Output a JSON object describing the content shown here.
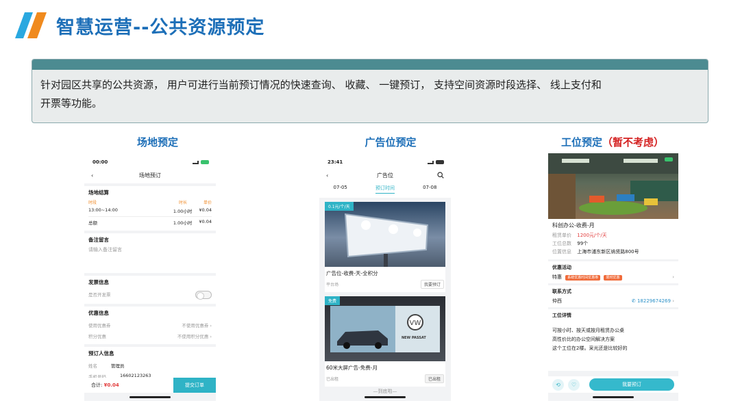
{
  "header": {
    "title": "智慧运营--公共资源预定"
  },
  "description": {
    "line1": "针对园区共享的公共资源， 用户可进行当前预订情况的快速查询、 收藏、 一键预订， 支持空间资源时段选择、 线上支付和",
    "line2": "开票等功能。"
  },
  "columns": {
    "venue_title": "场地预定",
    "ad_title": "广告位预定",
    "workspace_title": "工位预定",
    "workspace_note": "（暂不考虑）"
  },
  "venue_phone": {
    "time": "00:00",
    "nav_title": "场地预订",
    "settle": {
      "title": "场地结算",
      "headers": [
        "时段",
        "时长",
        "单价"
      ],
      "row": [
        "13:00~14:00",
        "1.00小时",
        "¥0.04"
      ],
      "total_label": "总额",
      "total_hours": "1.00小时",
      "total_price": "¥0.04"
    },
    "remark": {
      "title": "备注留言",
      "placeholder": "请输入备注留言"
    },
    "invoice": {
      "title": "发票信息",
      "label": "是否开发票"
    },
    "discount": {
      "title": "优惠信息",
      "coupon_label": "使用优惠券",
      "coupon_value": "不使用优惠券",
      "points_label": "积分优惠",
      "points_value": "不使用积分优惠"
    },
    "booker": {
      "title": "预订人信息",
      "name_label": "姓名",
      "name_value": "管理员",
      "phone_label": "手机号码",
      "phone_value": "16602123263"
    },
    "footer": {
      "total_label": "合计:",
      "total_value": "¥0.04",
      "submit": "提交订单"
    }
  },
  "ad_phone": {
    "time": "23:41",
    "nav_title": "广告位",
    "tabs": [
      "07-05",
      "预订时间",
      "07-08"
    ],
    "card1": {
      "badge": "0.1元/个/天",
      "title": "广告位-收费-天-全积分",
      "meta": "平台场",
      "button": "我要预订"
    },
    "card2": {
      "badge": "免费",
      "title": "60米大屏广告-免费-月",
      "meta": "已出租",
      "button": "已出租",
      "brand": "NEW PASSAT"
    },
    "footer_hint": "—到底啦—"
  },
  "workspace_phone": {
    "name": "科创办公-收费-月",
    "price_label": "租赁单价",
    "price_value": "1200元/个/天",
    "count_label": "工位总数",
    "count_value": "99个",
    "address_label": "位置信息",
    "address_value": "上海市浦东新区纳贤路800号",
    "promo": {
      "title": "优惠活动",
      "label": "特惠",
      "tag1": "系统优惠时间优惠券",
      "tag2": "限时优惠"
    },
    "contact": {
      "title": "联系方式",
      "name": "仲西",
      "phone": "18229674269"
    },
    "detail": {
      "title": "工位详情",
      "lines": [
        "可按小时、按天或按月租赁办公桌",
        "高性价比的办公空间解决方案",
        "这个工位在2楼。采光还是比较好的"
      ]
    },
    "footer": {
      "book": "我要预订"
    }
  },
  "colors": {
    "accent_blue": "#1d6fb8",
    "teal": "#2fb3c6",
    "bar": "#4c8b91",
    "warn_red": "#d42020"
  }
}
